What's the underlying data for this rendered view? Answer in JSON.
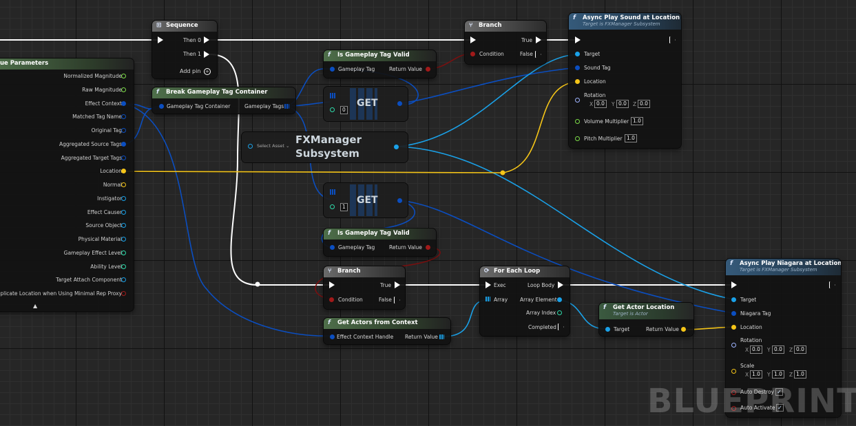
{
  "watermark": "BLUEPRINT",
  "colors": {
    "exec": "#ffffff",
    "struct": "#0b4ec0",
    "object": "#1aa1e8",
    "vector": "#f5c518",
    "bool": "#a11a1a",
    "float": "#7ddd49",
    "name": "#c094e8",
    "int": "#2fdcab"
  },
  "cue_params": {
    "title": "Cue Parameters",
    "title_visible": "ue Parameters",
    "pins": [
      {
        "label": "Normalized Magnitude",
        "type": "float"
      },
      {
        "label": "Raw Magnitude",
        "type": "float"
      },
      {
        "label": "Effect Context",
        "type": "struct"
      },
      {
        "label": "Matched Tag Name",
        "type": "struct"
      },
      {
        "label": "Original Tag",
        "type": "struct"
      },
      {
        "label": "Aggregated Source Tags",
        "type": "struct"
      },
      {
        "label": "Aggregated Target Tags",
        "type": "struct"
      },
      {
        "label": "Location",
        "type": "vector"
      },
      {
        "label": "Normal",
        "type": "vector"
      },
      {
        "label": "Instigator",
        "type": "object"
      },
      {
        "label": "Effect Causer",
        "type": "object"
      },
      {
        "label": "Source Object",
        "type": "object"
      },
      {
        "label": "Physical Material",
        "type": "object"
      },
      {
        "label": "Gameplay Effect Level",
        "type": "int"
      },
      {
        "label": "Ability Level",
        "type": "int"
      },
      {
        "label": "Target Attach Component",
        "type": "object"
      },
      {
        "label": "plicate Location when Using Minimal Rep Proxy",
        "type": "bool"
      }
    ],
    "collapse": "▲"
  },
  "sequence": {
    "title": "Sequence",
    "then0": "Then 0",
    "then1": "Then 1",
    "add_pin": "Add pin"
  },
  "break_tag": {
    "title": "Break Gameplay Tag Container",
    "in": "Gameplay Tag Container",
    "out": "Gameplay Tags"
  },
  "tag_valid_1": {
    "title": "Is Gameplay Tag Valid",
    "in": "Gameplay Tag",
    "out": "Return Value"
  },
  "tag_valid_2": {
    "title": "Is Gameplay Tag Valid",
    "in": "Gameplay Tag",
    "out": "Return Value"
  },
  "branch_1": {
    "title": "Branch",
    "condition": "Condition",
    "true": "True",
    "false": "False"
  },
  "branch_2": {
    "title": "Branch",
    "condition": "Condition",
    "true": "True",
    "false": "False"
  },
  "get_1": {
    "title": "GET",
    "index": "0"
  },
  "get_2": {
    "title": "GET",
    "index": "1"
  },
  "fxmanager": {
    "title_1": "FXManager",
    "title_2": "Subsystem",
    "select": "Select Asset"
  },
  "async_sound": {
    "title": "Async Play Sound at Location",
    "subtitle": "Target is FXManager Subsystem",
    "target": "Target",
    "sound_tag": "Sound Tag",
    "location": "Location",
    "rotation": "Rotation",
    "rot_x": "0.0",
    "rot_y": "0.0",
    "rot_z": "0.0",
    "volume": "Volume Multiplier",
    "volume_val": "1.0",
    "pitch": "Pitch Multiplier",
    "pitch_val": "1.0",
    "x": "X",
    "y": "Y",
    "z": "Z"
  },
  "get_actors": {
    "title": "Get Actors from Context",
    "in": "Effect Context Handle",
    "out": "Return Value"
  },
  "for_each": {
    "title": "For Each Loop",
    "exec": "Exec",
    "array": "Array",
    "loop_body": "Loop Body",
    "element": "Array Element",
    "index": "Array Index",
    "completed": "Completed"
  },
  "actor_loc": {
    "title": "Get Actor Location",
    "subtitle": "Target is Actor",
    "target": "Target",
    "out": "Return Value"
  },
  "async_niagara": {
    "title": "Async Play Niagara at Location",
    "subtitle": "Target is FXManager Subsystem",
    "target": "Target",
    "niagara_tag": "Niagara Tag",
    "location": "Location",
    "rotation": "Rotation",
    "rot_x": "0.0",
    "rot_y": "0.0",
    "rot_z": "0.0",
    "scale": "Scale",
    "scale_x": "1.0",
    "scale_y": "1.0",
    "scale_z": "1.0",
    "auto_destroy": "Auto Destroy",
    "auto_activate": "Auto Activate",
    "x": "X",
    "y": "Y",
    "z": "Z",
    "check": "✓"
  }
}
